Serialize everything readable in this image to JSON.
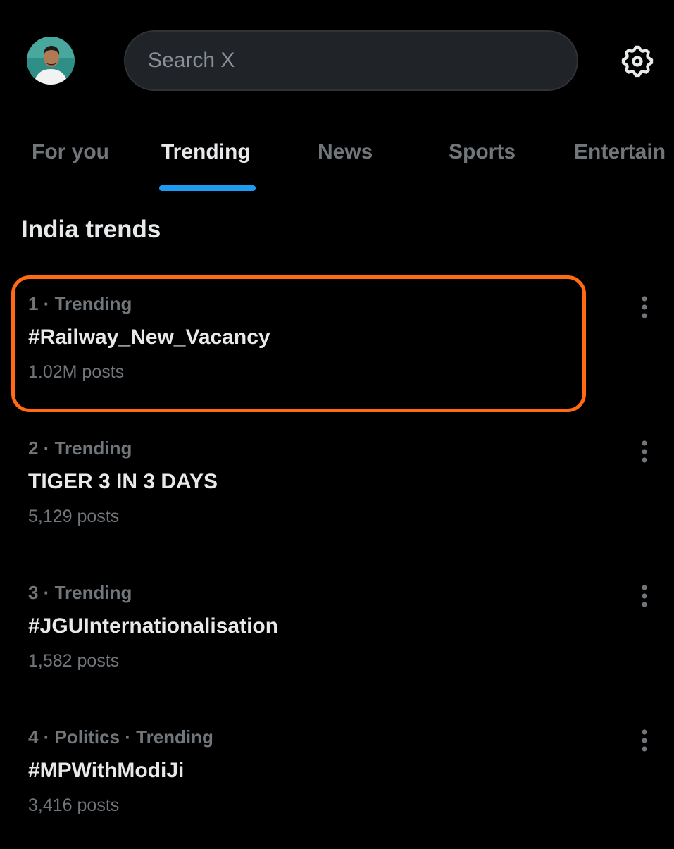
{
  "header": {
    "search_placeholder": "Search X",
    "avatar_icon": "profile-avatar",
    "settings_icon": "gear-icon"
  },
  "tabs": [
    {
      "label": "For you",
      "active": false
    },
    {
      "label": "Trending",
      "active": true
    },
    {
      "label": "News",
      "active": false
    },
    {
      "label": "Sports",
      "active": false
    },
    {
      "label": "Entertain",
      "active": false
    }
  ],
  "section": {
    "title": "India trends"
  },
  "trends": [
    {
      "meta": "1 · Trending",
      "name": "#Railway_New_Vacancy",
      "count": "1.02M posts"
    },
    {
      "meta": "2 · Trending",
      "name": "TIGER 3 IN 3 DAYS",
      "count": "5,129 posts"
    },
    {
      "meta": "3 · Trending",
      "name": "#JGUInternationalisation",
      "count": "1,582 posts"
    },
    {
      "meta": "4 · Politics · Trending",
      "name": "#MPWithModiJi",
      "count": "3,416 posts"
    }
  ],
  "colors": {
    "background": "#000000",
    "accent": "#1d9bf0",
    "highlight": "#ff6a13",
    "primary_text": "#e7e9ea",
    "secondary_text": "#71767b"
  }
}
